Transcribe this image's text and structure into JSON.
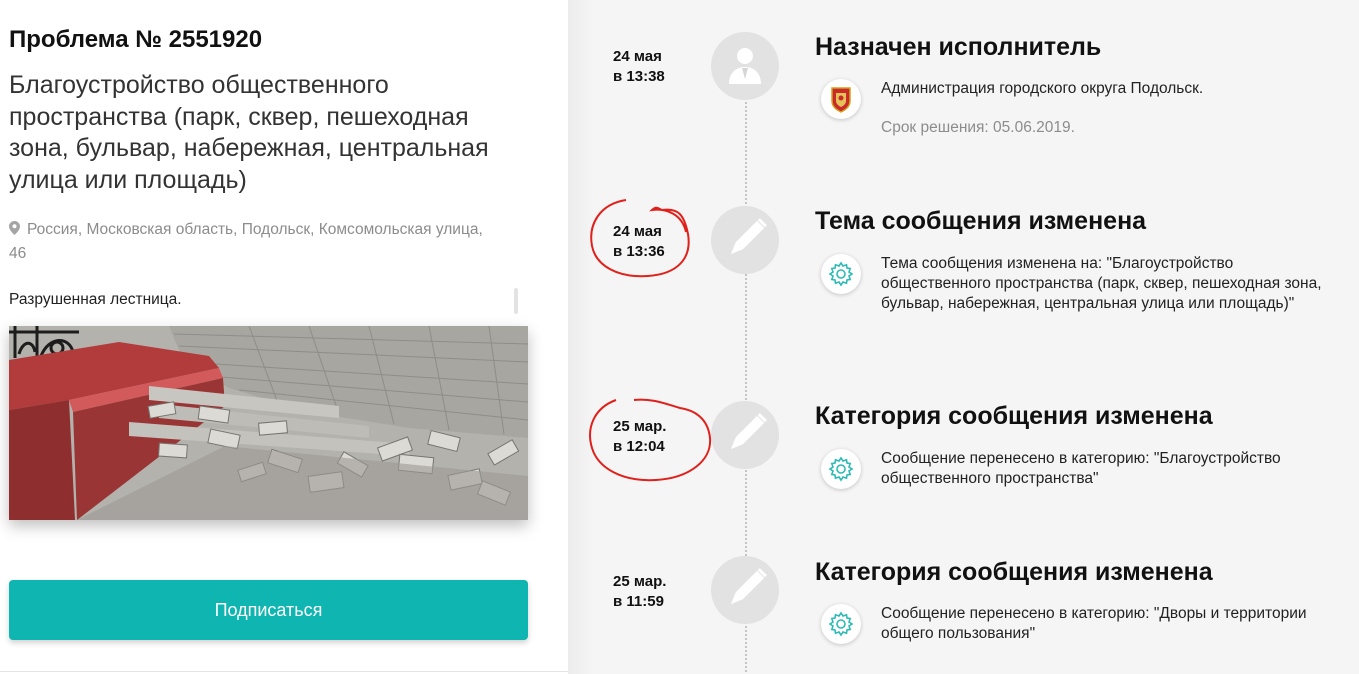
{
  "problem": {
    "title": "Проблема № 2551920",
    "category": "Благоустройство общественного пространства (парк, сквер, пешеходная зона, бульвар, набережная, центральная улица или площадь)",
    "address": "Россия, Московская область, Подольск, Комсомольская улица, 46",
    "description": "Разрушенная лестница.",
    "photo_icon": "photo-broken-stairs",
    "subscribe_label": "Подписаться"
  },
  "colors": {
    "accent": "#0fb5b0",
    "annotation": "#e0201b",
    "event_icon": "#2cbab5"
  },
  "timeline": [
    {
      "date_line1": "24 мая",
      "date_line2": "в 13:38",
      "circle_icon": "user-icon",
      "title": "Назначен исполнитель",
      "detail_icon": "moscow-region-emblem-icon",
      "text": "Администрация городского округа Подольск.",
      "deadline": "Срок решения: 05.06.2019."
    },
    {
      "date_line1": "24 мая",
      "date_line2": "в 13:36",
      "circle_icon": "pencil-icon",
      "title": "Тема сообщения изменена",
      "detail_icon": "gear-icon",
      "text": "Тема сообщения изменена на: \"Благоустройство общественного пространства (парк, сквер, пешеходная зона, бульвар, набережная, центральная улица или площадь)\""
    },
    {
      "date_line1": "25 мар.",
      "date_line2": "в 12:04",
      "circle_icon": "pencil-icon",
      "title": "Категория сообщения изменена",
      "detail_icon": "gear-icon",
      "text": "Сообщение перенесено в категорию: \"Благоустройство общественного пространства\""
    },
    {
      "date_line1": "25 мар.",
      "date_line2": "в 11:59",
      "circle_icon": "pencil-icon",
      "title": "Категория сообщения изменена",
      "detail_icon": "gear-icon",
      "text": "Сообщение перенесено в категорию: \"Дворы и территории общего пользования\""
    }
  ]
}
